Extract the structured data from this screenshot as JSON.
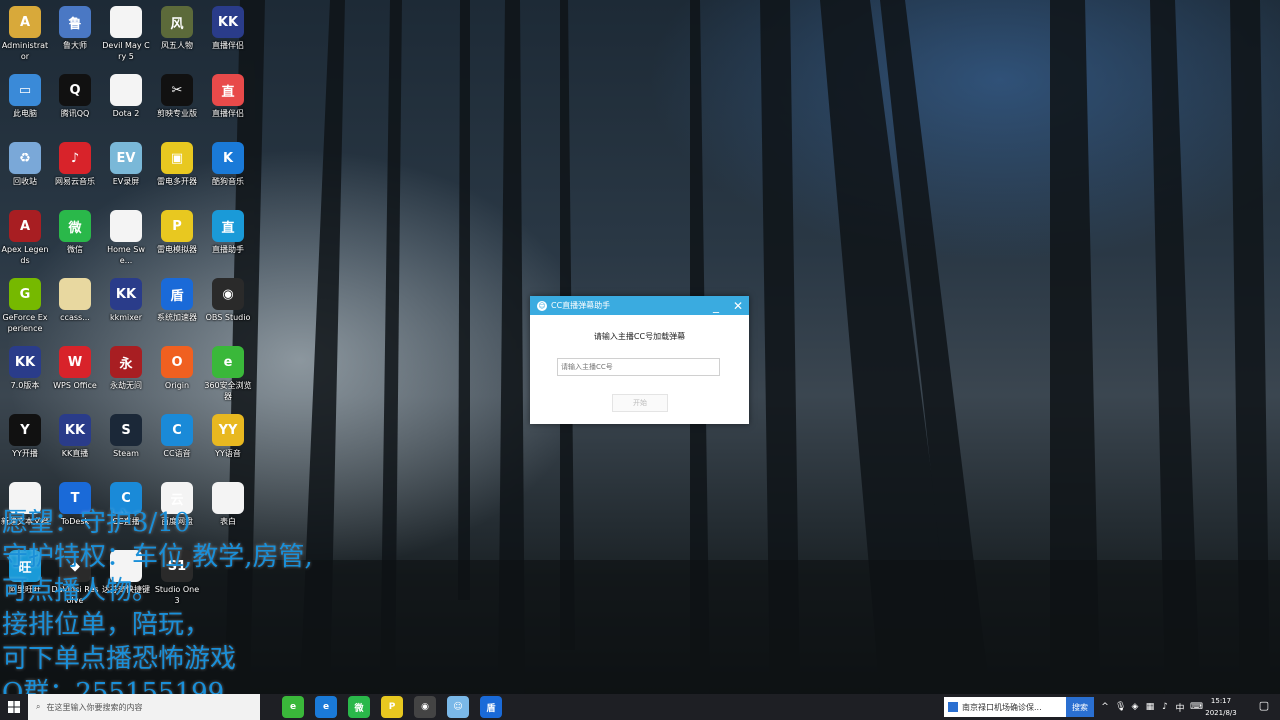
{
  "desktop_icons": [
    {
      "label": "Administrator",
      "color": "#d8a93a",
      "glyph": "A"
    },
    {
      "label": "鲁大师",
      "color": "#4a78c4",
      "glyph": "鲁"
    },
    {
      "label": "Devil May Cry 5",
      "color": "#f4f4f4",
      "glyph": ""
    },
    {
      "label": "风五人物",
      "color": "#5c6a3a",
      "glyph": "风"
    },
    {
      "label": "直播伴侣",
      "color": "#2a3c8a",
      "glyph": "KK"
    },
    {
      "label": "此电脑",
      "color": "#3a8ad8",
      "glyph": "▭"
    },
    {
      "label": "腾讯QQ",
      "color": "#111111",
      "glyph": "Q"
    },
    {
      "label": "Dota 2",
      "color": "#f4f4f4",
      "glyph": ""
    },
    {
      "label": "剪映专业版",
      "color": "#111111",
      "glyph": "✂"
    },
    {
      "label": "直播伴侣",
      "color": "#e84a4a",
      "glyph": "直"
    },
    {
      "label": "回收站",
      "color": "#7aa8d8",
      "glyph": "♻"
    },
    {
      "label": "网易云音乐",
      "color": "#d8232a",
      "glyph": "♪"
    },
    {
      "label": "EV录屏",
      "color": "#7ab8d8",
      "glyph": "EV"
    },
    {
      "label": "雷电多开器",
      "color": "#e8c820",
      "glyph": "▣"
    },
    {
      "label": "酷狗音乐",
      "color": "#1a7ad8",
      "glyph": "K"
    },
    {
      "label": "Apex Legends",
      "color": "#a81e22",
      "glyph": "A"
    },
    {
      "label": "微信",
      "color": "#2ab84a",
      "glyph": "微"
    },
    {
      "label": "Home Swe...",
      "color": "#f4f4f4",
      "glyph": ""
    },
    {
      "label": "雷电模拟器",
      "color": "#e8c820",
      "glyph": "P"
    },
    {
      "label": "直播助手",
      "color": "#1a9ad8",
      "glyph": "直"
    },
    {
      "label": "GeForce Experience",
      "color": "#76b900",
      "glyph": "G"
    },
    {
      "label": "ccass...",
      "color": "#e8d8a0",
      "glyph": ""
    },
    {
      "label": "kkmixer",
      "color": "#2a3c8a",
      "glyph": "KK"
    },
    {
      "label": "系统加速器",
      "color": "#1a6ad8",
      "glyph": "盾"
    },
    {
      "label": "OBS Studio",
      "color": "#2a2a2a",
      "glyph": "◉"
    },
    {
      "label": "7.0版本",
      "color": "#2a3c8a",
      "glyph": "KK"
    },
    {
      "label": "WPS Office",
      "color": "#d8232a",
      "glyph": "W"
    },
    {
      "label": "永劫无间",
      "color": "#a81e22",
      "glyph": "永"
    },
    {
      "label": "Origin",
      "color": "#f06020",
      "glyph": "O"
    },
    {
      "label": "360安全浏览器",
      "color": "#3ab83a",
      "glyph": "e"
    },
    {
      "label": "YY开播",
      "color": "#111111",
      "glyph": "Y"
    },
    {
      "label": "KK直播",
      "color": "#2a3c8a",
      "glyph": "KK"
    },
    {
      "label": "Steam",
      "color": "#1b2838",
      "glyph": "S"
    },
    {
      "label": "CC语音",
      "color": "#1a8ad8",
      "glyph": "C"
    },
    {
      "label": "YY语音",
      "color": "#e8b820",
      "glyph": "YY"
    },
    {
      "label": "新建文本文档",
      "color": "#f4f4f4",
      "glyph": ""
    },
    {
      "label": "ToDesk",
      "color": "#1a6ad8",
      "glyph": "T"
    },
    {
      "label": "CC直播",
      "color": "#1a8ad8",
      "glyph": "C"
    },
    {
      "label": "百度网盘",
      "color": "#f4f4f4",
      "glyph": "云"
    },
    {
      "label": "表白",
      "color": "#f4f4f4",
      "glyph": ""
    },
    {
      "label": "阿里旺旺",
      "color": "#1a9ad8",
      "glyph": "旺"
    },
    {
      "label": "DaVinci Resolve",
      "color": "#2a2a2a",
      "glyph": "◆"
    },
    {
      "label": "达芬奇快捷键",
      "color": "#f4f4f4",
      "glyph": ""
    },
    {
      "label": "Studio One 3",
      "color": "#2a2a2a",
      "glyph": "S1"
    }
  ],
  "overlay_text": [
    "愿望：守护3/10",
    "守护特权：车位,教学,房管,",
    "可点播人物。",
    "接排位单，陪玩，",
    "可下单点播恐怖游戏",
    "Q群：255155199"
  ],
  "dialog": {
    "title": "CC直播弹幕助手",
    "prompt": "请输入主播CC号加载弹幕",
    "input_placeholder": "请输入主播CC号",
    "input_value": "",
    "start_button": "开始",
    "minimize": "_",
    "close": "✕"
  },
  "taskbar": {
    "search_placeholder": "在这里输入你要搜索的内容",
    "news_text": "南京禄口机场确诊保...",
    "news_button": "搜索",
    "ime": "中",
    "time": "15:17",
    "date": "2021/8/3"
  },
  "taskbar_apps": [
    {
      "name": "360-browser",
      "color": "#3ab83a",
      "glyph": "e"
    },
    {
      "name": "edge",
      "color": "#1a7ad8",
      "glyph": "e"
    },
    {
      "name": "wechat",
      "color": "#2ab84a",
      "glyph": "微"
    },
    {
      "name": "leidian",
      "color": "#e8c820",
      "glyph": "P"
    },
    {
      "name": "obs",
      "color": "#444444",
      "glyph": "◉"
    },
    {
      "name": "cc-assistant",
      "color": "#7ab8e8",
      "glyph": "☺"
    },
    {
      "name": "shield",
      "color": "#1a6ad8",
      "glyph": "盾"
    }
  ]
}
